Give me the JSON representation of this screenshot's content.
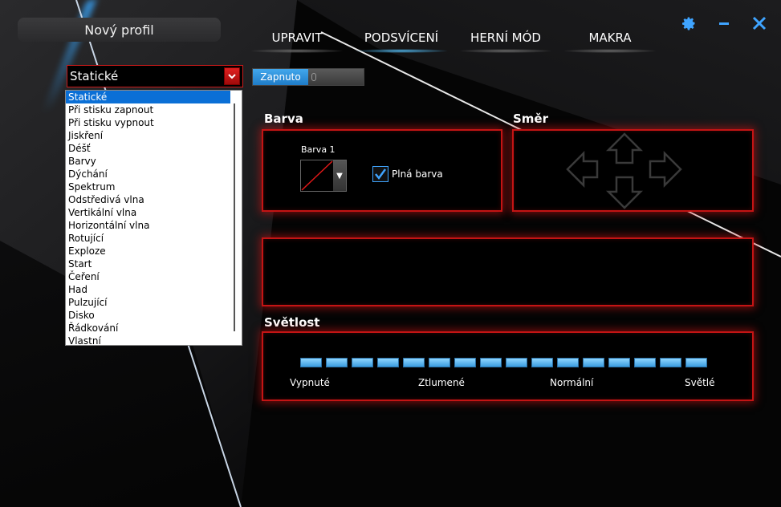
{
  "app": {
    "profile_name": "Nový profil"
  },
  "window_controls": [
    {
      "name": "settings-gear-icon",
      "glyph": "⚙"
    },
    {
      "name": "minimize-icon",
      "glyph": "–"
    },
    {
      "name": "close-icon",
      "glyph": "✕"
    }
  ],
  "nav": {
    "tabs": [
      {
        "label": "UPRAVIT",
        "active": false
      },
      {
        "label": "PODSVÍCENÍ",
        "active": true
      },
      {
        "label": "HERNÍ MÓD",
        "active": false
      },
      {
        "label": "MAKRA",
        "active": false
      }
    ]
  },
  "effect": {
    "selected": "Statické",
    "options": [
      "Statické",
      "Při stisku zapnout",
      "Při stisku vypnout",
      "Jiskření",
      "Déšť",
      "Barvy",
      "Dýchání",
      "Spektrum",
      "Odstředivá vlna",
      "Vertikální vlna",
      "Horizontální vlna",
      "Rotující",
      "Exploze",
      "Start",
      "Čeření",
      "Had",
      "Pulzující",
      "Disko",
      "Řádkování",
      "Vlastní"
    ]
  },
  "toggle": {
    "label": "Zapnuto",
    "on": true
  },
  "color_section": {
    "title": "Barva",
    "color1_label": "Barva 1",
    "solid_label": "Plná barva",
    "solid_checked": true
  },
  "direction_section": {
    "title": "Směr"
  },
  "brightness_section": {
    "title": "Světlost",
    "segments_total": 16,
    "segments_filled": 16,
    "labels": [
      "Vypnuté",
      "Ztlumené",
      "Normální",
      "Světlé"
    ]
  },
  "colors": {
    "accent_blue": "#3fa4ff",
    "panel_red": "#c41414"
  }
}
